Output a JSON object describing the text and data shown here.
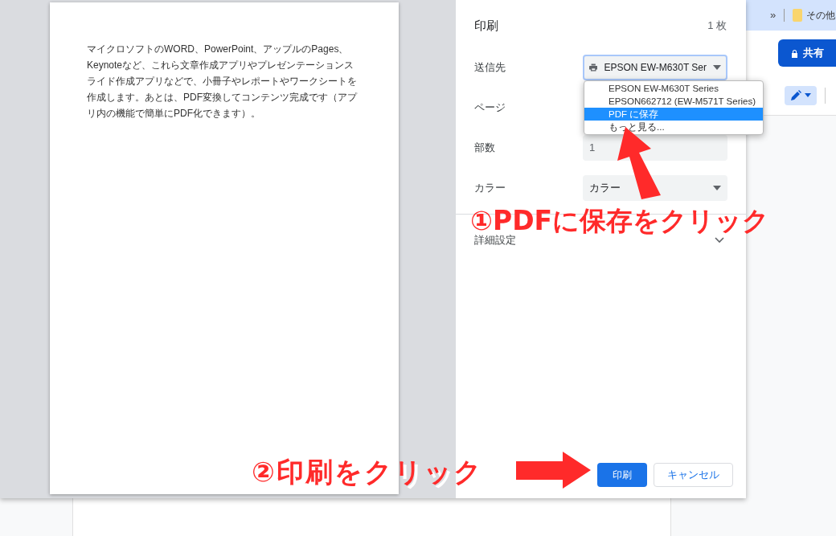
{
  "preview": {
    "paragraph": "マイクロソフトのWORD、PowerPoint、アップルのPages、Keynoteなど、これら文章作成アプリやプレゼンテーションスライド作成アプリなどで、小冊子やレポートやワークシートを作成します。あとは、PDF変換してコンテンツ完成です（アプリ内の機能で簡単にPDF化できます）。"
  },
  "print_panel": {
    "title": "印刷",
    "sheet_count": "1 枚",
    "fields": [
      {
        "label": "送信先",
        "kind": "printer_select",
        "value": "EPSON EW-M630T Ser"
      },
      {
        "label": "ページ",
        "kind": "covered"
      },
      {
        "label": "部数",
        "kind": "input",
        "value": "1"
      },
      {
        "label": "カラー",
        "kind": "select",
        "value": "カラー"
      }
    ],
    "more_settings": {
      "label": "詳細設定",
      "expanded": false
    },
    "buttons": [
      {
        "label": "印刷",
        "kind": "primary"
      },
      {
        "label": "キャンセル",
        "kind": "secondary"
      }
    ]
  },
  "destination_menu": [
    {
      "label": "EPSON EW-M630T Series",
      "selected": false
    },
    {
      "label": "EPSON662712 (EW-M571T Series)",
      "selected": false
    },
    {
      "label": "PDF に保存",
      "selected": true
    },
    {
      "label": "もっと見る...",
      "selected": false
    }
  ],
  "annotations": [
    {
      "text": "①PDFに保存をクリック"
    },
    {
      "text": "②印刷をクリック"
    }
  ],
  "browser": {
    "bookmarks_overflow": "»",
    "bookmark_folder": "その他",
    "share_button": "共有"
  }
}
